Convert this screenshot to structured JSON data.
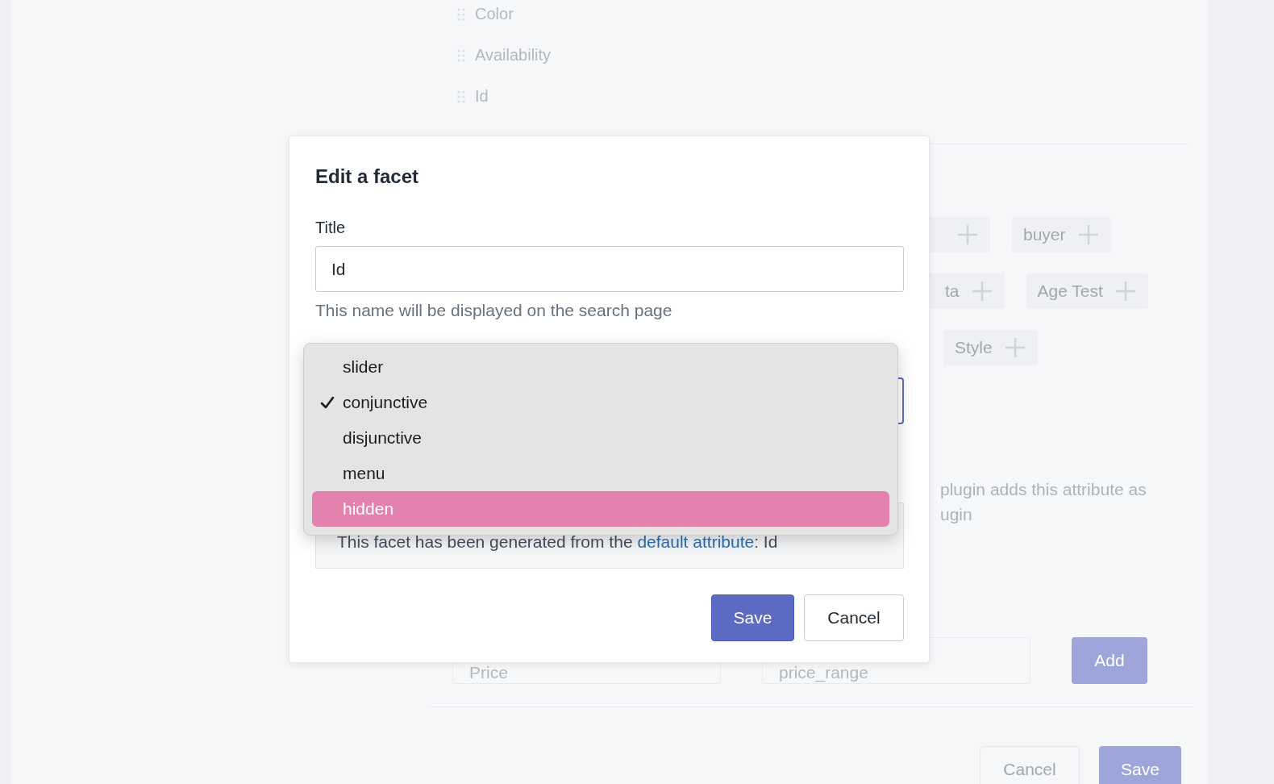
{
  "background": {
    "facet_list": [
      {
        "label": "Color"
      },
      {
        "label": "Availability"
      },
      {
        "label": "Id"
      }
    ],
    "tag_rows": [
      [
        {
          "kind": "icon_only"
        },
        {
          "kind": "labeled",
          "label": "buyer"
        }
      ],
      [
        {
          "kind": "labeled",
          "label": "ta"
        },
        {
          "kind": "labeled",
          "label": "Age Test"
        }
      ],
      [
        {
          "kind": "labeled",
          "label": "Style"
        }
      ]
    ],
    "note_lines": [
      "plugin adds this attribute as",
      "ugin"
    ],
    "new_facet": {
      "title_placeholder": "Price",
      "attribute_placeholder": "price_range",
      "add_button": "Add"
    },
    "footer_buttons": [
      {
        "label": "Cancel",
        "kind": "secondary"
      },
      {
        "label": "Save",
        "kind": "primary"
      }
    ]
  },
  "dialog": {
    "title": "Edit a facet",
    "title_label": "Title",
    "title_value": "Id",
    "title_help": "This name will be displayed on the search page",
    "info_before": "This facet has been generated from the ",
    "info_link": "default attribute",
    "info_after": ": Id",
    "buttons": [
      {
        "label": "Save",
        "kind": "primary"
      },
      {
        "label": "Cancel",
        "kind": "secondary"
      }
    ]
  },
  "dropdown": {
    "options": [
      {
        "label": "slider",
        "checked": false,
        "selected": false
      },
      {
        "label": "conjunctive",
        "checked": true,
        "selected": false
      },
      {
        "label": "disjunctive",
        "checked": false,
        "selected": false
      },
      {
        "label": "menu",
        "checked": false,
        "selected": false
      },
      {
        "label": "hidden",
        "checked": false,
        "selected": true
      }
    ]
  }
}
